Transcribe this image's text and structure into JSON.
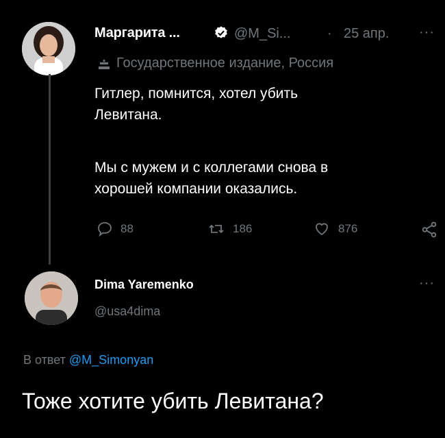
{
  "tweet1": {
    "author_name": "Маргарита ...",
    "handle": "@M_Si...",
    "separator": "·",
    "date": "25 апр.",
    "label": "Государственное издание, Россия",
    "text_line1": "Гитлер, помнится, хотел убить",
    "text_line2": "Левитана.",
    "text_line3": "Мы с мужем и с коллегами снова в",
    "text_line4": "хорошей компании оказались.",
    "replies": "88",
    "retweets": "186",
    "likes": "876",
    "more": "···"
  },
  "tweet2": {
    "author_name": "Dima Yaremenko",
    "handle": "@usa4dima",
    "more": "···",
    "reply_prefix": "В ответ",
    "reply_to": "@M_Simonyan",
    "text": "Тоже хотите убить Левитана?"
  },
  "colors": {
    "background": "#000000",
    "text": "#ffffff",
    "muted": "#71767b",
    "link": "#1d9bf0",
    "verified": "#ffffff"
  }
}
